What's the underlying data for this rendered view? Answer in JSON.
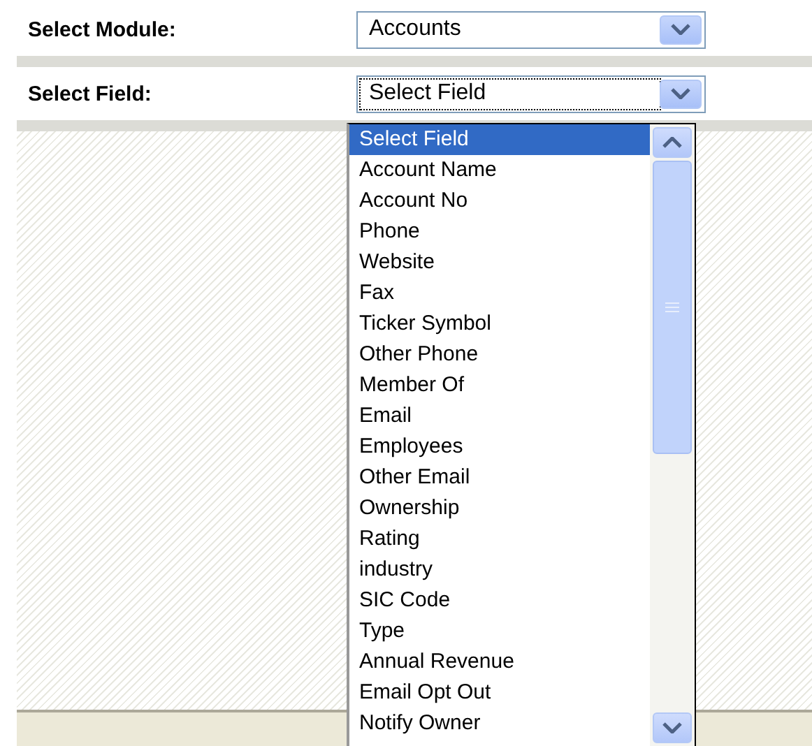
{
  "fields": [
    {
      "label": "Select Module:",
      "value": "Accounts",
      "focused": false
    },
    {
      "label": "Select Field:",
      "value": "Select Field",
      "focused": true
    }
  ],
  "dropdown": {
    "options": [
      {
        "label": "Select Field",
        "selected": true
      },
      {
        "label": "Account Name",
        "selected": false
      },
      {
        "label": "Account No",
        "selected": false
      },
      {
        "label": "Phone",
        "selected": false
      },
      {
        "label": "Website",
        "selected": false
      },
      {
        "label": "Fax",
        "selected": false
      },
      {
        "label": "Ticker Symbol",
        "selected": false
      },
      {
        "label": "Other Phone",
        "selected": false
      },
      {
        "label": "Member Of",
        "selected": false
      },
      {
        "label": "Email",
        "selected": false
      },
      {
        "label": "Employees",
        "selected": false
      },
      {
        "label": "Other Email",
        "selected": false
      },
      {
        "label": "Ownership",
        "selected": false
      },
      {
        "label": "Rating",
        "selected": false
      },
      {
        "label": "industry",
        "selected": false
      },
      {
        "label": "SIC Code",
        "selected": false
      },
      {
        "label": "Type",
        "selected": false
      },
      {
        "label": "Annual Revenue",
        "selected": false
      },
      {
        "label": "Email Opt Out",
        "selected": false
      },
      {
        "label": "Notify Owner",
        "selected": false
      }
    ]
  }
}
